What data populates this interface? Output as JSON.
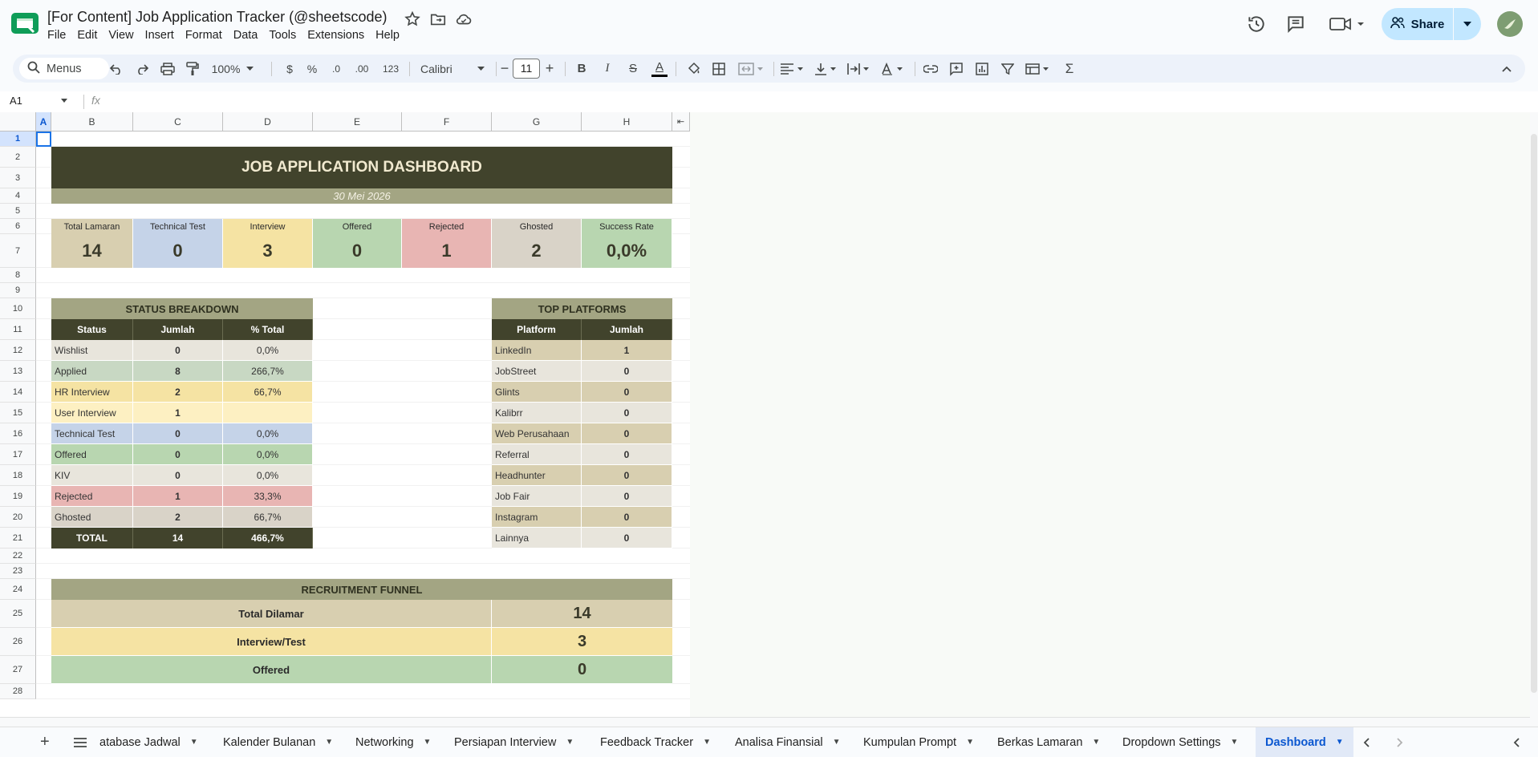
{
  "window": {
    "doc_title": "[For Content] Job Application Tracker (@sheetscode)",
    "menu": [
      "File",
      "Edit",
      "View",
      "Insert",
      "Format",
      "Data",
      "Tools",
      "Extensions",
      "Help"
    ],
    "share_label": "Share"
  },
  "toolbar": {
    "search_label": "Menus",
    "zoom": "100%",
    "currency": "$",
    "percent": "%",
    "dec_decrease": ".0",
    "dec_increase": ".00",
    "number_format": "123",
    "font": "Calibri",
    "font_size": "11",
    "bold": "B",
    "italic": "I",
    "strike": "S",
    "text_color": "A",
    "sum": "Σ"
  },
  "formula_bar": {
    "name_box": "A1",
    "fx": "fx",
    "content": ""
  },
  "columns": [
    "A",
    "B",
    "C",
    "D",
    "E",
    "F",
    "G",
    "H"
  ],
  "rows": [
    "1",
    "2",
    "3",
    "4",
    "5",
    "6",
    "7",
    "8",
    "9",
    "10",
    "11",
    "12",
    "13",
    "14",
    "15",
    "16",
    "17",
    "18",
    "19",
    "20",
    "21",
    "22",
    "23",
    "24",
    "25",
    "26",
    "27",
    "28"
  ],
  "dashboard": {
    "title": "JOB APPLICATION DASHBOARD",
    "date": "30 Mei 2026",
    "kpis": [
      {
        "label": "Total Lamaran",
        "value": "14",
        "color": "#d8cfb0"
      },
      {
        "label": "Technical Test",
        "value": "0",
        "color": "#c5d3e8"
      },
      {
        "label": "Interview",
        "value": "3",
        "color": "#f5e3a3"
      },
      {
        "label": "Offered",
        "value": "0",
        "color": "#b8d6b0"
      },
      {
        "label": "Rejected",
        "value": "1",
        "color": "#e8b5b3"
      },
      {
        "label": "Ghosted",
        "value": "2",
        "color": "#d9d3c8"
      },
      {
        "label": "Success Rate",
        "value": "0,0%",
        "color": "#b8d6b0"
      }
    ],
    "status_breakdown": {
      "title": "STATUS BREAKDOWN",
      "headers": [
        "Status",
        "Jumlah",
        "% Total"
      ],
      "rows": [
        {
          "status": "Wishlist",
          "jumlah": "0",
          "pct": "0,0%",
          "color": "#e8e5dc"
        },
        {
          "status": "Applied",
          "jumlah": "8",
          "pct": "266,7%",
          "color": "#c8d8c3"
        },
        {
          "status": "HR Interview",
          "jumlah": "2",
          "pct": "66,7%",
          "color": "#f5e3a3"
        },
        {
          "status": "User Interview",
          "jumlah": "1",
          "pct": "",
          "color": "#fdf0c2"
        },
        {
          "status": "Technical Test",
          "jumlah": "0",
          "pct": "0,0%",
          "color": "#c5d3e8"
        },
        {
          "status": "Offered",
          "jumlah": "0",
          "pct": "0,0%",
          "color": "#b8d6b0"
        },
        {
          "status": "KIV",
          "jumlah": "0",
          "pct": "0,0%",
          "color": "#e8e5dc"
        },
        {
          "status": "Rejected",
          "jumlah": "1",
          "pct": "33,3%",
          "color": "#e8b5b3"
        },
        {
          "status": "Ghosted",
          "jumlah": "2",
          "pct": "66,7%",
          "color": "#d9d3c8"
        }
      ],
      "total": {
        "label": "TOTAL",
        "jumlah": "14",
        "pct": "466,7%"
      }
    },
    "top_platforms": {
      "title": "TOP PLATFORMS",
      "headers": [
        "Platform",
        "Jumlah"
      ],
      "rows": [
        {
          "platform": "LinkedIn",
          "jumlah": "1"
        },
        {
          "platform": "JobStreet",
          "jumlah": "0"
        },
        {
          "platform": "Glints",
          "jumlah": "0"
        },
        {
          "platform": "Kalibrr",
          "jumlah": "0"
        },
        {
          "platform": "Web Perusahaan",
          "jumlah": "0"
        },
        {
          "platform": "Referral",
          "jumlah": "0"
        },
        {
          "platform": "Headhunter",
          "jumlah": "0"
        },
        {
          "platform": "Job Fair",
          "jumlah": "0"
        },
        {
          "platform": "Instagram",
          "jumlah": "0"
        },
        {
          "platform": "Lainnya",
          "jumlah": "0"
        }
      ]
    },
    "funnel": {
      "title": "RECRUITMENT FUNNEL",
      "rows": [
        {
          "label": "Total Dilamar",
          "value": "14",
          "color": "#d8cfb0"
        },
        {
          "label": "Interview/Test",
          "value": "3",
          "color": "#f5e3a3"
        },
        {
          "label": "Offered",
          "value": "0",
          "color": "#b8d6b0"
        }
      ]
    }
  },
  "colors": {
    "dark_header": "#41432c",
    "olive_band": "#a3a583",
    "title_text": "#f1ead0",
    "platform_odd": "#d8cfb0",
    "platform_even": "#e8e5dc"
  },
  "tabs": [
    {
      "label": "atabase Jadwal"
    },
    {
      "label": "Kalender Bulanan"
    },
    {
      "label": "Networking"
    },
    {
      "label": "Persiapan Interview"
    },
    {
      "label": "Feedback Tracker"
    },
    {
      "label": "Analisa Finansial"
    },
    {
      "label": "Kumpulan Prompt"
    },
    {
      "label": "Berkas Lamaran"
    },
    {
      "label": "Dropdown Settings"
    },
    {
      "label": "Dashboard",
      "active": true
    }
  ]
}
